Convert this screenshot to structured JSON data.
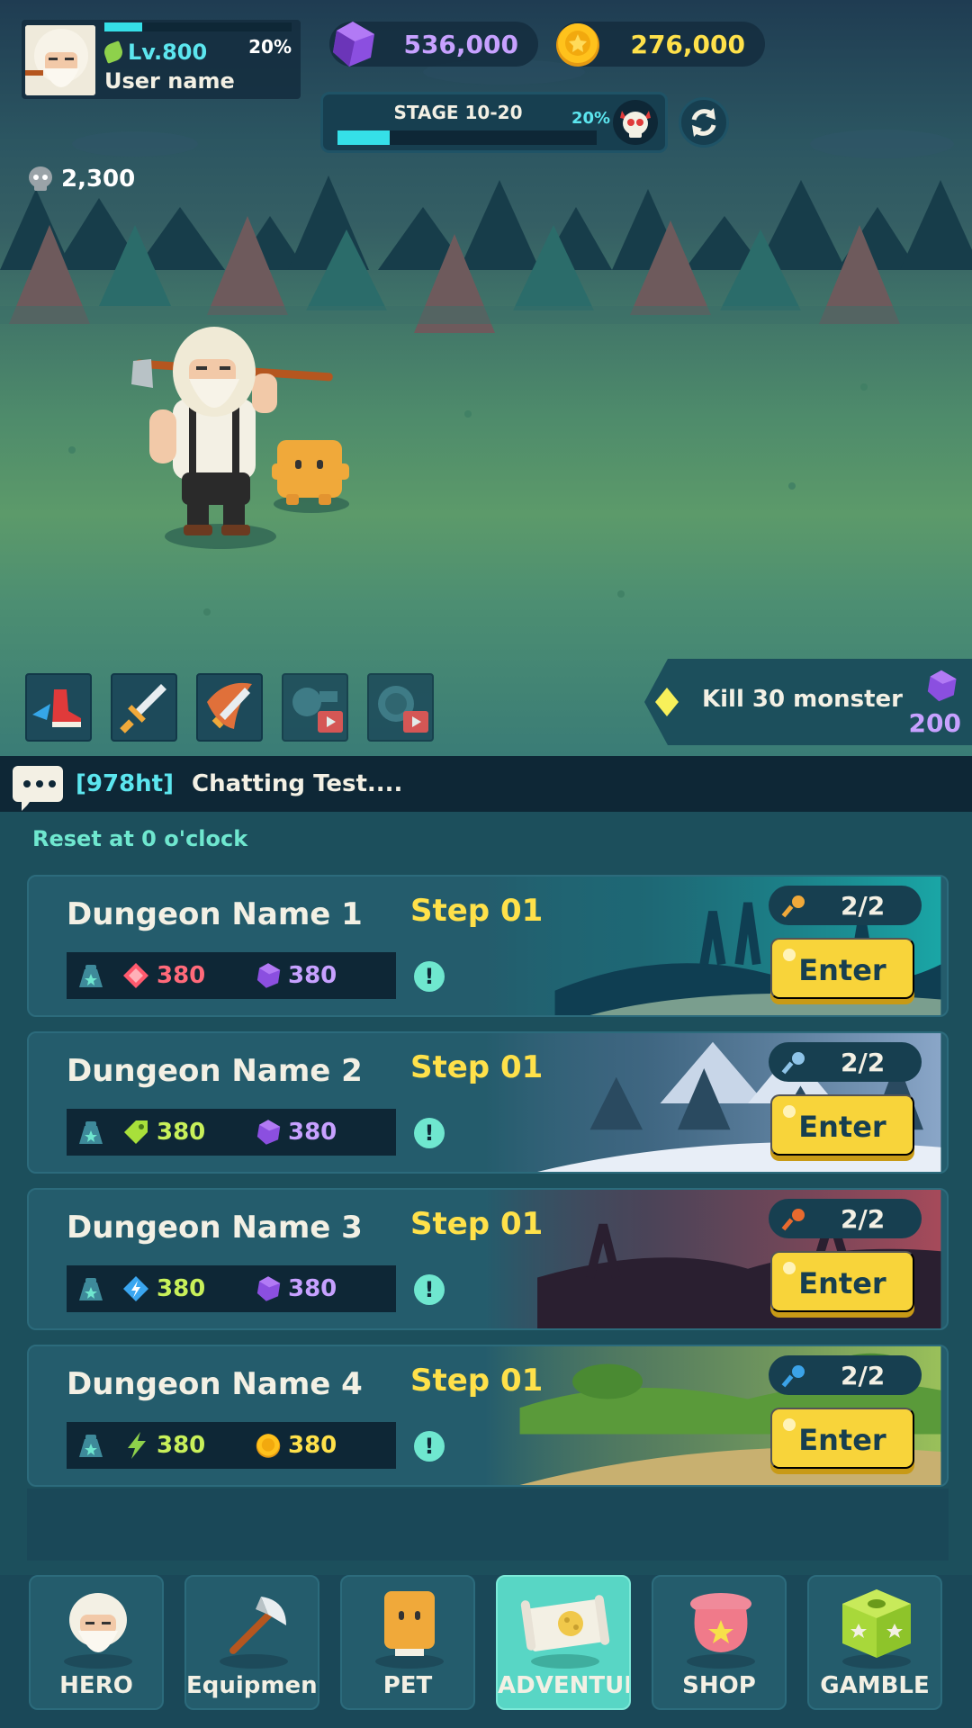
{
  "profile": {
    "level_label": "Lv.800",
    "xp_percent_label": "20%",
    "xp_fraction": 0.2,
    "username": "User name"
  },
  "currencies": {
    "gems": "536,000",
    "gold": "276,000"
  },
  "stage": {
    "label": "STAGE 10-20",
    "percent_label": "20%",
    "progress_fraction": 0.2
  },
  "kill_count": "2,300",
  "skills": [
    "rush-skill",
    "sword-skill",
    "flame-sword-skill",
    "exp-ad-boost",
    "coin-ad-boost"
  ],
  "quest": {
    "text": "Kill 30 monster",
    "reward": "200"
  },
  "chat": {
    "user_tag": "[978ht]",
    "message": "Chatting Test...."
  },
  "dungeons": {
    "reset_text": "Reset at 0 o'clock",
    "items": [
      {
        "name": "Dungeon Name 1",
        "step": "Step 01",
        "reward1": "380",
        "reward2": "380",
        "keys": "2/2",
        "enter": "Enter",
        "reward1_icon": "red-gem-icon",
        "reward2_icon": "purple-gem-icon",
        "key_color": "#f0a93a"
      },
      {
        "name": "Dungeon Name 2",
        "step": "Step 01",
        "reward1": "380",
        "reward2": "380",
        "keys": "2/2",
        "enter": "Enter",
        "reward1_icon": "green-tag-icon",
        "reward2_icon": "purple-gem-icon",
        "key_color": "#8fc4e8"
      },
      {
        "name": "Dungeon Name 3",
        "step": "Step 01",
        "reward1": "380",
        "reward2": "380",
        "keys": "2/2",
        "enter": "Enter",
        "reward1_icon": "blue-bolt-icon",
        "reward2_icon": "purple-gem-icon",
        "key_color": "#e86a2e"
      },
      {
        "name": "Dungeon Name 4",
        "step": "Step 01",
        "reward1": "380",
        "reward2": "380",
        "keys": "2/2",
        "enter": "Enter",
        "reward1_icon": "green-bolt-icon",
        "reward2_icon": "gold-coin-icon",
        "key_color": "#3ba3e8"
      }
    ]
  },
  "nav": [
    {
      "label": "HERO",
      "active": false
    },
    {
      "label": "Equipment",
      "active": false
    },
    {
      "label": "PET",
      "active": false
    },
    {
      "label": "ADVENTURE",
      "active": true
    },
    {
      "label": "SHOP",
      "active": false
    },
    {
      "label": "GAMBLE",
      "active": false
    }
  ],
  "colors": {
    "accent_cyan": "#35e0e8",
    "gem_purple": "#c7a1ff",
    "gold_yellow": "#ffe14a",
    "button_yellow": "#f8d43a",
    "panel_teal": "#1c4f5c"
  }
}
